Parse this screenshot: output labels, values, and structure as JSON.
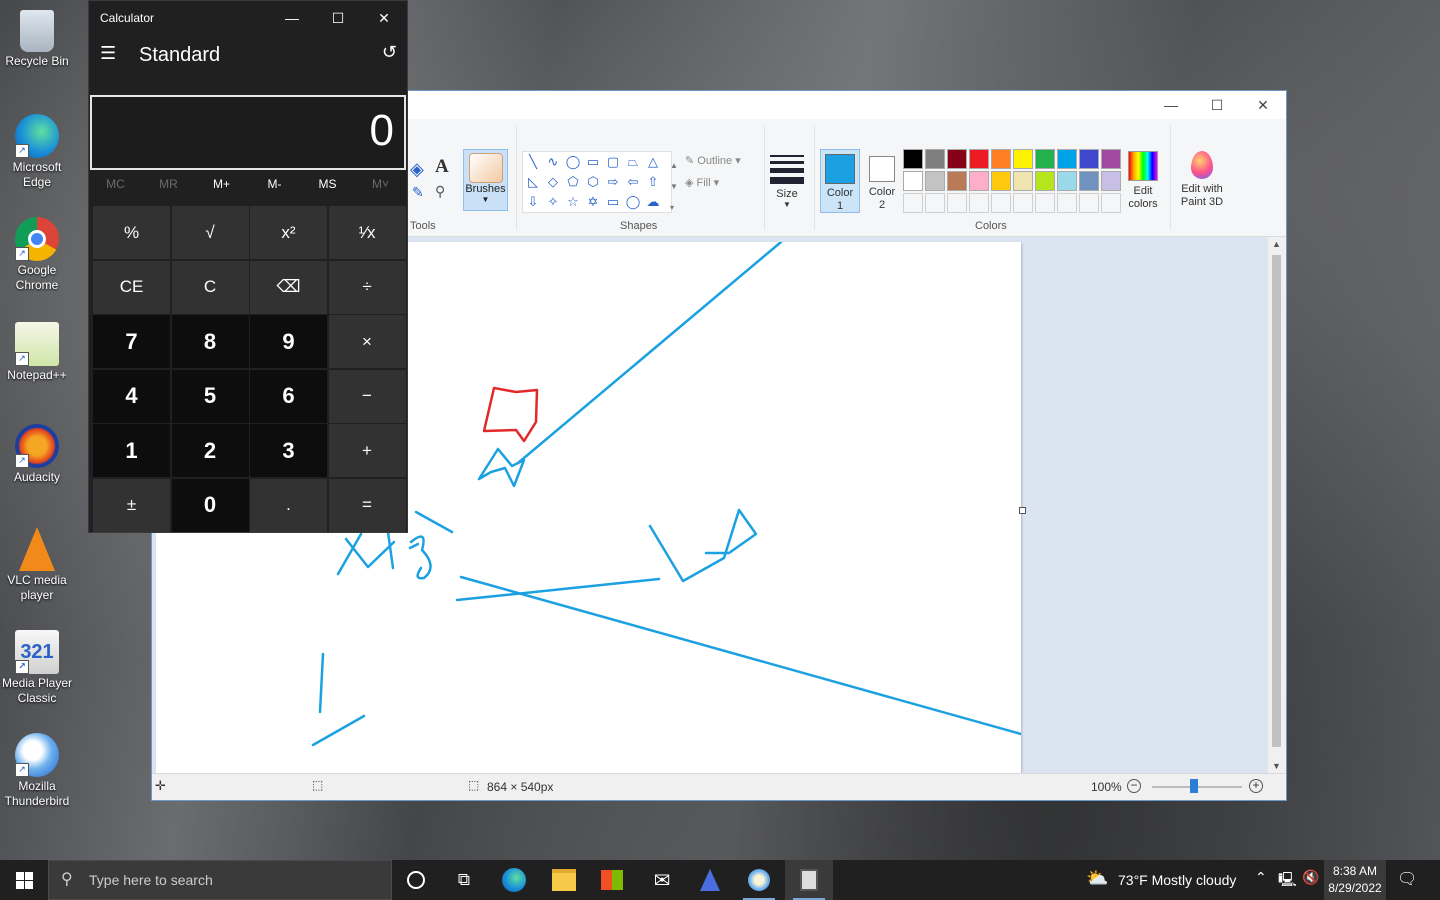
{
  "desktop": {
    "icons": [
      {
        "label": "Recycle Bin"
      },
      {
        "label": "Microsoft Edge"
      },
      {
        "label": "Google Chrome"
      },
      {
        "label": "Notepad++"
      },
      {
        "label": "Audacity"
      },
      {
        "label": "VLC media player"
      },
      {
        "label": "Media Player Classic"
      },
      {
        "label": "Mozilla Thunderbird"
      }
    ]
  },
  "calculator": {
    "title": "Calculator",
    "mode": "Standard",
    "display": "0",
    "memory": [
      "MC",
      "MR",
      "M+",
      "M-",
      "MS",
      "M˅"
    ],
    "keys": [
      "%",
      "√",
      "x²",
      "¹∕x",
      "CE",
      "C",
      "⌫",
      "÷",
      "7",
      "8",
      "9",
      "×",
      "4",
      "5",
      "6",
      "−",
      "1",
      "2",
      "3",
      "+",
      "±",
      "0",
      ".",
      "="
    ]
  },
  "paint": {
    "groups": {
      "tools": "Tools",
      "shapes": "Shapes",
      "colors": "Colors"
    },
    "brushes_label": "Brushes",
    "outline_label": "Outline",
    "fill_label": "Fill",
    "size_label": "Size",
    "color1_label": "Color 1",
    "color2_label": "Color 2",
    "edit_colors_label": "Edit colors",
    "edit_paint3d_label": "Edit with Paint 3D",
    "status": {
      "dimensions": "864 × 540px",
      "zoom": "100%"
    },
    "palette": [
      "#000000",
      "#7f7f7f",
      "#880015",
      "#ed1c24",
      "#ff7f27",
      "#fff200",
      "#22b14c",
      "#00a2e8",
      "#3f48cc",
      "#a349a4",
      "#ffffff",
      "#c3c3c3",
      "#b97a57",
      "#ffaec9",
      "#ffc90e",
      "#efe4b0",
      "#b5e61d",
      "#99d9ea",
      "#7092be",
      "#c8bfe7"
    ],
    "color1": "#1ba1e2",
    "color2": "#ffffff"
  },
  "taskbar": {
    "search_placeholder": "Type here to search",
    "weather": "73°F  Mostly cloudy",
    "time": "8:38 AM",
    "date": "8/29/2022"
  }
}
